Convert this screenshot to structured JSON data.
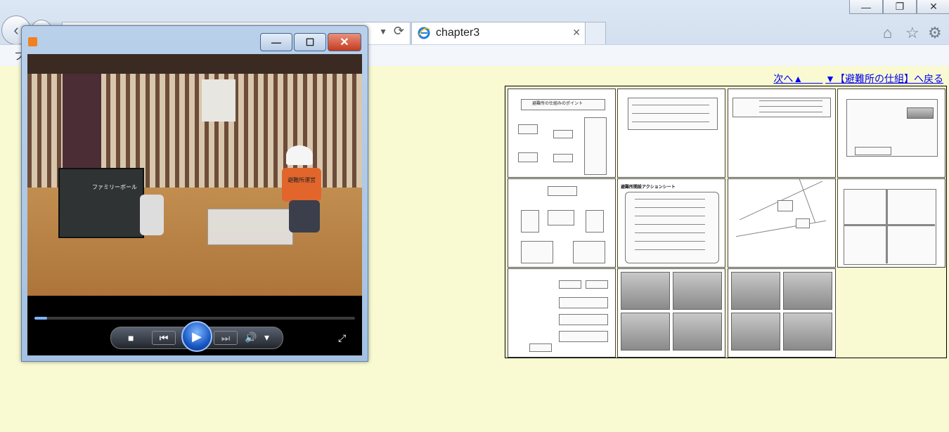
{
  "browser": {
    "tab_title": "chapter3",
    "tab_close": "✕",
    "menu_fragment": "フ",
    "window_controls": {
      "minimize": "—",
      "restore": "❐",
      "close": "✕"
    },
    "toolbar_icons": [
      "home-icon",
      "star-icon",
      "gear-icon"
    ]
  },
  "page": {
    "nav_links": [
      {
        "text": "次へ▲＿＿"
      },
      {
        "text": "▼【避難所の仕組】へ戻る"
      }
    ],
    "thumbnails": [
      {
        "id": "t1",
        "caption": "避難所の仕組みのポイント"
      },
      {
        "id": "t2",
        "caption": ""
      },
      {
        "id": "t3",
        "caption": ""
      },
      {
        "id": "t4",
        "caption": ""
      },
      {
        "id": "t5",
        "caption": ""
      },
      {
        "id": "t6",
        "caption": "避難所開設アクションシート"
      },
      {
        "id": "t7",
        "caption": ""
      },
      {
        "id": "t8",
        "caption": ""
      },
      {
        "id": "t9",
        "caption": ""
      },
      {
        "id": "t10",
        "caption": ""
      },
      {
        "id": "t11",
        "caption": ""
      }
    ]
  },
  "player": {
    "window_controls": {
      "minimize": "—",
      "maximize": "☐",
      "close": "✕"
    },
    "progress": 0.04,
    "controls": {
      "stop": "■",
      "prev": "⏮",
      "play": "▶",
      "next": "⏭",
      "volume": "🔊",
      "volume_menu": "▾",
      "fullscreen": "⤢"
    },
    "video_sign_text": "ファミリーボール",
    "video_vest_text": "避難所運営"
  }
}
